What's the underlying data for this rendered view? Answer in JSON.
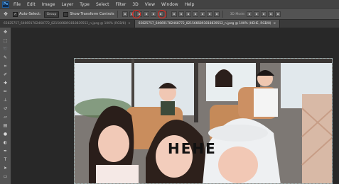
{
  "menubar": {
    "logo": "Ps",
    "items": [
      "File",
      "Edit",
      "Image",
      "Layer",
      "Type",
      "Select",
      "Filter",
      "3D",
      "View",
      "Window",
      "Help"
    ]
  },
  "options": {
    "auto_select_label": "Auto-Select:",
    "auto_select_target": "Group",
    "show_transform_controls": "Show Transform Controls",
    "mode_3d": "3D Mode:"
  },
  "tabs": [
    {
      "label": "65825757_646691782468772_8215666893818839552_n.jpeg @ 100% (RGB/8)",
      "active": false
    },
    {
      "label": "65825757_646691782468772_8215666893818839552_n.jpeg @ 100% (HEHE, RGB/8)",
      "active": true
    }
  ],
  "photo": {
    "overlay_text": "HEHE",
    "colors": {
      "window_light": "#dfe6ea",
      "seat": "#c98d5d",
      "hair": "#2a1e1a",
      "skin": "#f1c9b7"
    }
  },
  "tools": [
    "move",
    "marquee",
    "lasso",
    "quick-select",
    "crop",
    "eyedropper",
    "healing",
    "brush",
    "clone",
    "history-brush",
    "eraser",
    "gradient",
    "blur",
    "dodge",
    "pen",
    "type",
    "path-select",
    "shape",
    "hand",
    "zoom"
  ],
  "annotations": {
    "color": "#e3231b"
  }
}
